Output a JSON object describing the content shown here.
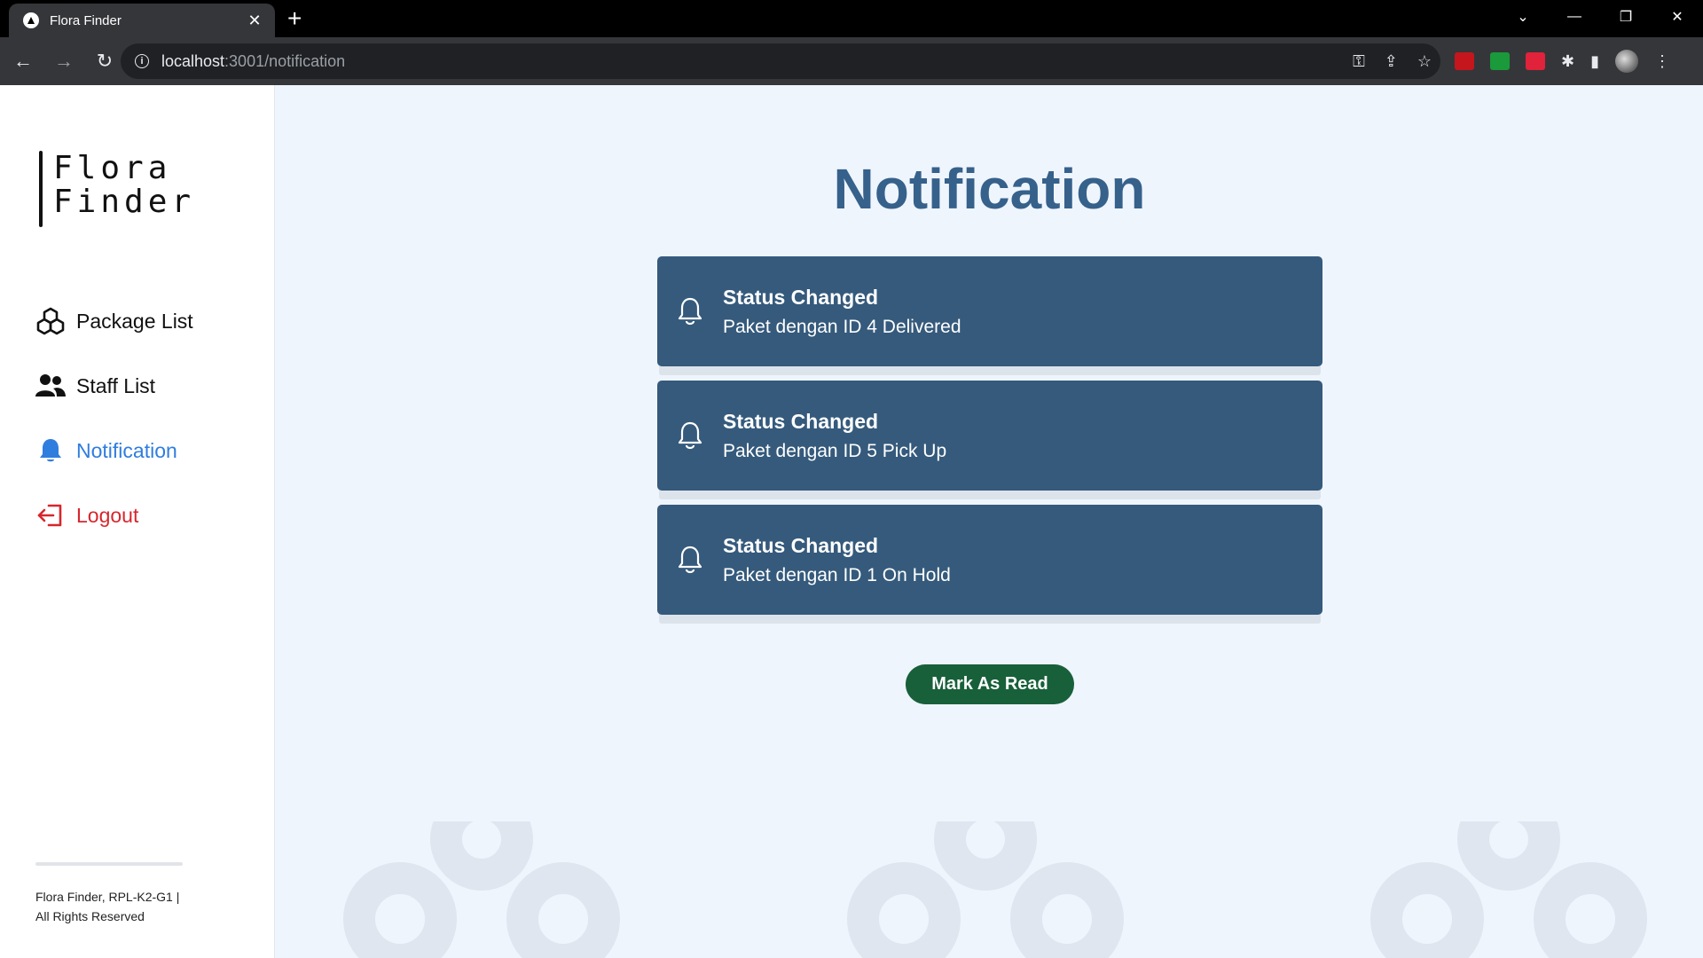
{
  "browser": {
    "tab_title": "Flora Finder",
    "tab_close": "✕",
    "new_tab": "+",
    "url_host": "localhost",
    "url_path": ":3001/notification"
  },
  "sidebar": {
    "logo_line1": "Flora",
    "logo_line2": "Finder",
    "items": [
      {
        "label": "Package List",
        "icon": "package-icon"
      },
      {
        "label": "Staff List",
        "icon": "staff-icon"
      },
      {
        "label": "Notification",
        "icon": "bell-icon",
        "active": true,
        "color": "#2f7ddf"
      },
      {
        "label": "Logout",
        "icon": "logout-icon",
        "color": "#d7262d"
      }
    ],
    "footer_line1": "Flora Finder, RPL-K2-G1 |",
    "footer_line2": "All Rights Reserved"
  },
  "main": {
    "title": "Notification",
    "notifications": [
      {
        "title": "Status Changed",
        "body": "Paket dengan ID 4 Delivered"
      },
      {
        "title": "Status Changed",
        "body": "Paket dengan ID 5 Pick Up"
      },
      {
        "title": "Status Changed",
        "body": "Paket dengan ID 1 On Hold"
      }
    ],
    "mark_button": "Mark As Read"
  },
  "colors": {
    "title": "#36618b",
    "card": "#355a7c",
    "button": "#18603a",
    "page_bg": "#eff5fd"
  }
}
